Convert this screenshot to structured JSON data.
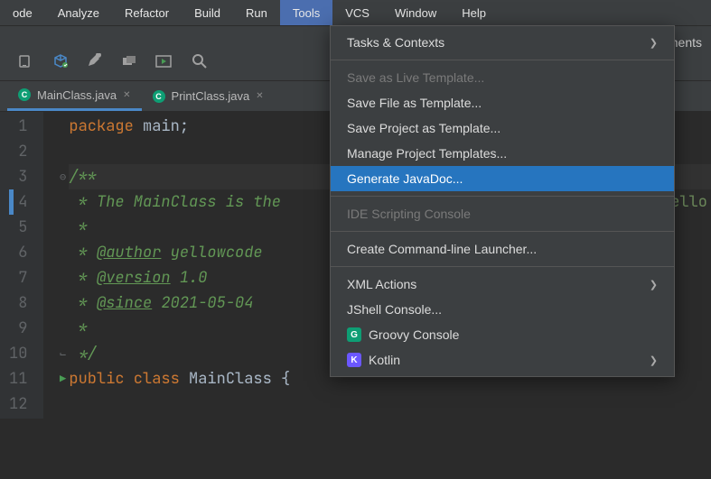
{
  "menubar": {
    "items": [
      "ode",
      "Analyze",
      "Refactor",
      "Build",
      "Run",
      "Tools",
      "VCS",
      "Window",
      "Help"
    ],
    "active": "Tools"
  },
  "toolbar": {
    "right_fragment": "ments"
  },
  "tabs": [
    {
      "label": "MainClass.java",
      "active": true
    },
    {
      "label": "PrintClass.java",
      "active": false
    }
  ],
  "dropdown": {
    "items": [
      {
        "label": "Tasks & Contexts",
        "submenu": true
      },
      {
        "sep": true
      },
      {
        "label": "Save as Live Template...",
        "disabled": true
      },
      {
        "label": "Save File as Template..."
      },
      {
        "label": "Save Project as Template..."
      },
      {
        "label": "Manage Project Templates..."
      },
      {
        "label": "Generate JavaDoc...",
        "highlighted": true
      },
      {
        "sep": true
      },
      {
        "label": "IDE Scripting Console",
        "disabled": true
      },
      {
        "sep": true
      },
      {
        "label": "Create Command-line Launcher..."
      },
      {
        "sep": true
      },
      {
        "label": "XML Actions",
        "submenu": true
      },
      {
        "label": "JShell Console..."
      },
      {
        "label": "Groovy Console",
        "icon": "groovy"
      },
      {
        "label": "Kotlin",
        "icon": "kotlin",
        "submenu": true
      }
    ]
  },
  "code": {
    "lines": [
      {
        "n": 1,
        "tokens": [
          {
            "t": "package ",
            "c": "kw"
          },
          {
            "t": "main;",
            "c": "pkg"
          }
        ]
      },
      {
        "n": 2,
        "tokens": []
      },
      {
        "n": 3,
        "tokens": [
          {
            "t": "/**",
            "c": "comment"
          }
        ],
        "fold": true,
        "highlight": true
      },
      {
        "n": 4,
        "tokens": [
          {
            "t": " * The MainClass is the ",
            "c": "comment"
          }
        ],
        "rstring": "\"Hello"
      },
      {
        "n": 5,
        "tokens": [
          {
            "t": " *",
            "c": "comment"
          }
        ]
      },
      {
        "n": 6,
        "tokens": [
          {
            "t": " * ",
            "c": "comment"
          },
          {
            "t": "@author",
            "c": "tag"
          },
          {
            "t": " yellowcode",
            "c": "comment"
          }
        ]
      },
      {
        "n": 7,
        "tokens": [
          {
            "t": " * ",
            "c": "comment"
          },
          {
            "t": "@version",
            "c": "tag"
          },
          {
            "t": " 1.0",
            "c": "comment"
          }
        ]
      },
      {
        "n": 8,
        "tokens": [
          {
            "t": " * ",
            "c": "comment"
          },
          {
            "t": "@since",
            "c": "tag"
          },
          {
            "t": " 2021-05-04",
            "c": "comment"
          }
        ]
      },
      {
        "n": 9,
        "tokens": [
          {
            "t": " *",
            "c": "comment"
          }
        ]
      },
      {
        "n": 10,
        "tokens": [
          {
            "t": " */",
            "c": "comment"
          }
        ],
        "foldend": true
      },
      {
        "n": 11,
        "tokens": [
          {
            "t": "public class ",
            "c": "kw"
          },
          {
            "t": "MainClass {",
            "c": "classname"
          }
        ],
        "run": true
      },
      {
        "n": 12,
        "tokens": []
      }
    ]
  }
}
